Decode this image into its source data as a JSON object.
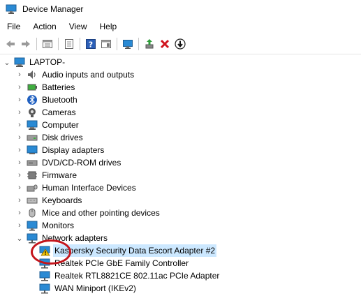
{
  "window": {
    "title": "Device Manager"
  },
  "menu": [
    "File",
    "Action",
    "View",
    "Help"
  ],
  "toolbar": {
    "icons": [
      "back-icon",
      "forward-icon",
      "properties-icon",
      "show-hide-tree-icon",
      "help-icon",
      "action-pane-icon",
      "scan-hardware-icon",
      "update-driver-icon",
      "uninstall-icon",
      "disable-icon"
    ]
  },
  "tree": {
    "root": "LAPTOP-",
    "categories": [
      {
        "label": "Audio inputs and outputs",
        "icon": "speaker-icon"
      },
      {
        "label": "Batteries",
        "icon": "battery-icon"
      },
      {
        "label": "Bluetooth",
        "icon": "bluetooth-icon"
      },
      {
        "label": "Cameras",
        "icon": "camera-icon"
      },
      {
        "label": "Computer",
        "icon": "computer-icon"
      },
      {
        "label": "Disk drives",
        "icon": "disk-icon"
      },
      {
        "label": "Display adapters",
        "icon": "display-icon"
      },
      {
        "label": "DVD/CD-ROM drives",
        "icon": "dvd-icon"
      },
      {
        "label": "Firmware",
        "icon": "firmware-icon"
      },
      {
        "label": "Human Interface Devices",
        "icon": "hid-icon"
      },
      {
        "label": "Keyboards",
        "icon": "keyboard-icon"
      },
      {
        "label": "Mice and other pointing devices",
        "icon": "mouse-icon"
      },
      {
        "label": "Monitors",
        "icon": "monitor-icon"
      },
      {
        "label": "Network adapters",
        "icon": "network-icon",
        "expanded": true
      }
    ],
    "network_children": [
      {
        "label": "Kaspersky Security Data Escort Adapter #2",
        "warning": true,
        "selected": true
      },
      {
        "label": "Realtek PCIe GbE Family Controller"
      },
      {
        "label": "Realtek RTL8821CE 802.11ac PCIe Adapter"
      },
      {
        "label": "WAN Miniport (IKEv2)"
      }
    ]
  },
  "colors": {
    "selection": "#cce8ff",
    "annotation": "#c4161c",
    "warning": "#f2c200"
  }
}
